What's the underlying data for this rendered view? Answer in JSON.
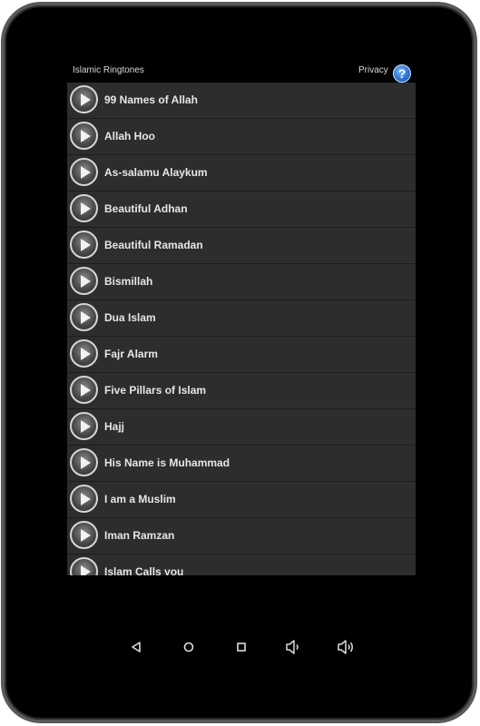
{
  "app": {
    "title": "Islamic Ringtones",
    "privacy_label": "Privacy",
    "help_label": "?"
  },
  "ringtones": [
    {
      "label": "99 Names of Allah"
    },
    {
      "label": "Allah Hoo"
    },
    {
      "label": "As-salamu Alaykum"
    },
    {
      "label": "Beautiful Adhan"
    },
    {
      "label": "Beautiful Ramadan"
    },
    {
      "label": "Bismillah"
    },
    {
      "label": "Dua Islam"
    },
    {
      "label": "Fajr Alarm"
    },
    {
      "label": "Five Pillars of Islam"
    },
    {
      "label": "Hajj"
    },
    {
      "label": "His Name is Muhammad"
    },
    {
      "label": "I am a Muslim"
    },
    {
      "label": "Iman Ramzan"
    },
    {
      "label": "Islam Calls you"
    }
  ],
  "navbar": {
    "icons": [
      "back-icon",
      "home-icon",
      "recents-icon",
      "volume-down-icon",
      "volume-up-icon"
    ]
  },
  "colors": {
    "row_background": "#2d2d2d",
    "help_accent": "#2a77d8",
    "text": "#e6e6e6"
  }
}
